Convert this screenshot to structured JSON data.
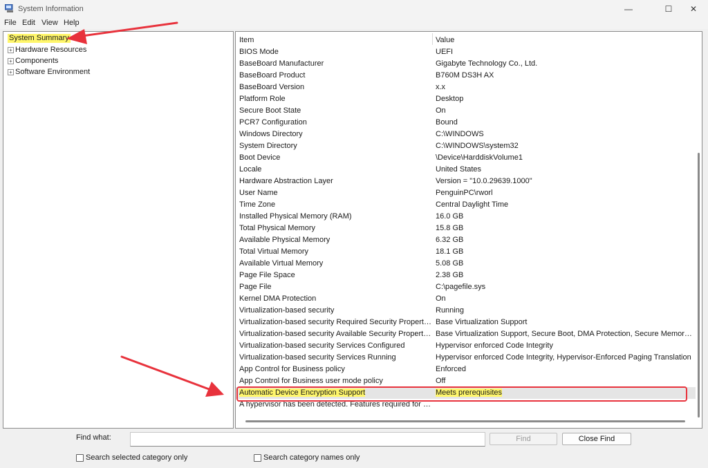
{
  "window": {
    "title": "System Information",
    "icon": "system-information-icon",
    "controls": {
      "minimize": "—",
      "maximize": "☐",
      "close": "✕"
    }
  },
  "menu": [
    "File",
    "Edit",
    "View",
    "Help"
  ],
  "tree": {
    "selected": "System Summary",
    "items": [
      {
        "label": "Hardware Resources",
        "expander": "+"
      },
      {
        "label": "Components",
        "expander": "+"
      },
      {
        "label": "Software Environment",
        "expander": "+"
      }
    ]
  },
  "table": {
    "headers": {
      "item": "Item",
      "value": "Value"
    },
    "rows": [
      [
        "BIOS Mode",
        "UEFI"
      ],
      [
        "BaseBoard Manufacturer",
        "Gigabyte Technology Co., Ltd."
      ],
      [
        "BaseBoard Product",
        "B760M DS3H AX"
      ],
      [
        "BaseBoard Version",
        "x.x"
      ],
      [
        "Platform Role",
        "Desktop"
      ],
      [
        "Secure Boot State",
        "On"
      ],
      [
        "PCR7 Configuration",
        "Bound"
      ],
      [
        "Windows Directory",
        "C:\\WINDOWS"
      ],
      [
        "System Directory",
        "C:\\WINDOWS\\system32"
      ],
      [
        "Boot Device",
        "\\Device\\HarddiskVolume1"
      ],
      [
        "Locale",
        "United States"
      ],
      [
        "Hardware Abstraction Layer",
        "Version = \"10.0.29639.1000\""
      ],
      [
        "User Name",
        "PenguinPC\\rworl"
      ],
      [
        "Time Zone",
        "Central Daylight Time"
      ],
      [
        "Installed Physical Memory (RAM)",
        "16.0 GB"
      ],
      [
        "Total Physical Memory",
        "15.8 GB"
      ],
      [
        "Available Physical Memory",
        "6.32 GB"
      ],
      [
        "Total Virtual Memory",
        "18.1 GB"
      ],
      [
        "Available Virtual Memory",
        "5.08 GB"
      ],
      [
        "Page File Space",
        "2.38 GB"
      ],
      [
        "Page File",
        "C:\\pagefile.sys"
      ],
      [
        "Kernel DMA Protection",
        "On"
      ],
      [
        "Virtualization-based security",
        "Running"
      ],
      [
        "Virtualization-based security Required Security Properties",
        "Base Virtualization Support"
      ],
      [
        "Virtualization-based security Available Security Properties",
        "Base Virtualization Support, Secure Boot, DMA Protection, Secure Memory Ov..."
      ],
      [
        "Virtualization-based security Services Configured",
        "Hypervisor enforced Code Integrity"
      ],
      [
        "Virtualization-based security Services Running",
        "Hypervisor enforced Code Integrity, Hypervisor-Enforced Paging Translation"
      ],
      [
        "App Control for Business policy",
        "Enforced"
      ],
      [
        "App Control for Business user mode policy",
        "Off"
      ]
    ],
    "highlighted_row": [
      "Automatic Device Encryption Support",
      "Meets prerequisites"
    ],
    "last_row": [
      "A hypervisor has been detected. Features required for H...",
      ""
    ]
  },
  "find": {
    "label": "Find what:",
    "value": "",
    "find_button": "Find",
    "close_button": "Close Find",
    "check_selected": "Search selected category only",
    "check_names": "Search category names only"
  },
  "colors": {
    "highlight": "#fff66b",
    "annotation_red": "#e8323c"
  }
}
